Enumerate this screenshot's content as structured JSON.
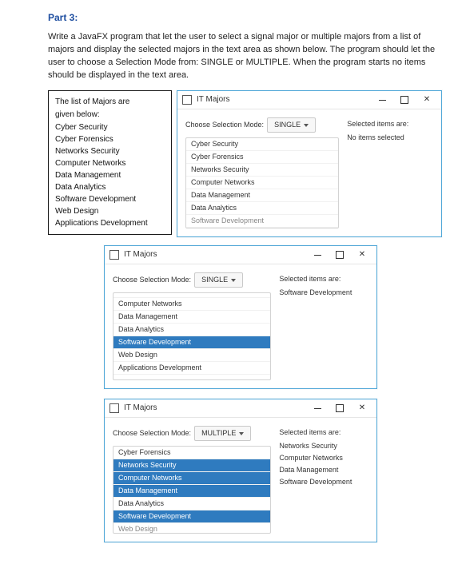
{
  "part_label": "Part 3:",
  "instructions": "Write a JavaFX program that let the user to select a signal major or multiple majors from a list of majors and display the selected majors in the text area as shown below. The program should let the user to choose a Selection Mode from: SINGLE or MULTIPLE. When the program starts no items should be displayed in the text area.",
  "majors_box": {
    "line1": "The list of Majors are",
    "line2": "given below:",
    "items": [
      "Cyber Security",
      "Cyber Forensics",
      "Networks Security",
      "Computer Networks",
      "Data Management",
      "Data Analytics",
      "Software Development",
      "Web Design",
      "Applications Development"
    ]
  },
  "window_title": "IT Majors",
  "mode_label": "Choose Selection Mode:",
  "mode_single": "SINGLE",
  "mode_multiple": "MULTIPLE",
  "selected_header": "Selected items are:",
  "w1": {
    "no_items": "No items selected",
    "list": [
      "Cyber Security",
      "Cyber Forensics",
      "Networks Security",
      "Computer Networks",
      "Data Management",
      "Data Analytics",
      "Software Development"
    ]
  },
  "w2": {
    "list_top_clipped": "",
    "list": [
      "Computer Networks",
      "Data Management",
      "Data Analytics",
      "Software Development",
      "Web Design",
      "Applications Development"
    ],
    "selected_index": 3,
    "selected_text": [
      "Software Development"
    ]
  },
  "w3": {
    "list": [
      "Cyber Forensics",
      "Networks Security",
      "Computer Networks",
      "Data Management",
      "Data Analytics",
      "Software Development",
      "Web Design"
    ],
    "selected_indices": [
      1,
      2,
      3,
      5
    ],
    "selected_text": [
      "Networks Security",
      "Computer Networks",
      "Data Management",
      "Software Development"
    ]
  }
}
